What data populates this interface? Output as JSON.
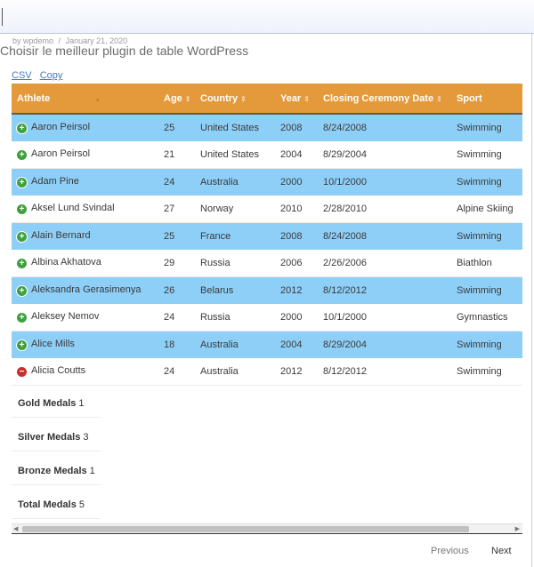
{
  "post": {
    "meta_author": "by wpdemo",
    "meta_sep": "/",
    "meta_date": "January 21, 2020",
    "title": "Choisir le meilleur plugin de table WordPress"
  },
  "export": {
    "csv": "CSV",
    "copy": "Copy"
  },
  "table": {
    "columns": [
      "Athlete",
      "Age",
      "Country",
      "Year",
      "Closing Ceremony Date",
      "Sport"
    ],
    "rows": [
      {
        "athlete": "Aaron Peirsol",
        "age": "25",
        "country": "United States",
        "year": "2008",
        "date": "8/24/2008",
        "sport": "Swimming",
        "toggle": "+"
      },
      {
        "athlete": "Aaron Peirsol",
        "age": "21",
        "country": "United States",
        "year": "2004",
        "date": "8/29/2004",
        "sport": "Swimming",
        "toggle": "+"
      },
      {
        "athlete": "Adam Pine",
        "age": "24",
        "country": "Australia",
        "year": "2000",
        "date": "10/1/2000",
        "sport": "Swimming",
        "toggle": "+"
      },
      {
        "athlete": "Aksel Lund Svindal",
        "age": "27",
        "country": "Norway",
        "year": "2010",
        "date": "2/28/2010",
        "sport": "Alpine Skiing",
        "toggle": "+"
      },
      {
        "athlete": "Alain Bernard",
        "age": "25",
        "country": "France",
        "year": "2008",
        "date": "8/24/2008",
        "sport": "Swimming",
        "toggle": "+"
      },
      {
        "athlete": "Albina Akhatova",
        "age": "29",
        "country": "Russia",
        "year": "2006",
        "date": "2/26/2006",
        "sport": "Biathlon",
        "toggle": "+"
      },
      {
        "athlete": "Aleksandra Gerasimenya",
        "age": "26",
        "country": "Belarus",
        "year": "2012",
        "date": "8/12/2012",
        "sport": "Swimming",
        "toggle": "+"
      },
      {
        "athlete": "Aleksey Nemov",
        "age": "24",
        "country": "Russia",
        "year": "2000",
        "date": "10/1/2000",
        "sport": "Gymnastics",
        "toggle": "+"
      },
      {
        "athlete": "Alice Mills",
        "age": "18",
        "country": "Australia",
        "year": "2004",
        "date": "8/29/2004",
        "sport": "Swimming",
        "toggle": "+"
      },
      {
        "athlete": "Alicia Coutts",
        "age": "24",
        "country": "Australia",
        "year": "2012",
        "date": "8/12/2012",
        "sport": "Swimming",
        "toggle": "−"
      }
    ]
  },
  "details": [
    {
      "label": "Gold Medals",
      "value": "1"
    },
    {
      "label": "Silver Medals",
      "value": "3"
    },
    {
      "label": "Bronze Medals",
      "value": "1"
    },
    {
      "label": "Total Medals",
      "value": "5"
    }
  ],
  "pagination": {
    "previous": "Previous",
    "next": "Next"
  }
}
